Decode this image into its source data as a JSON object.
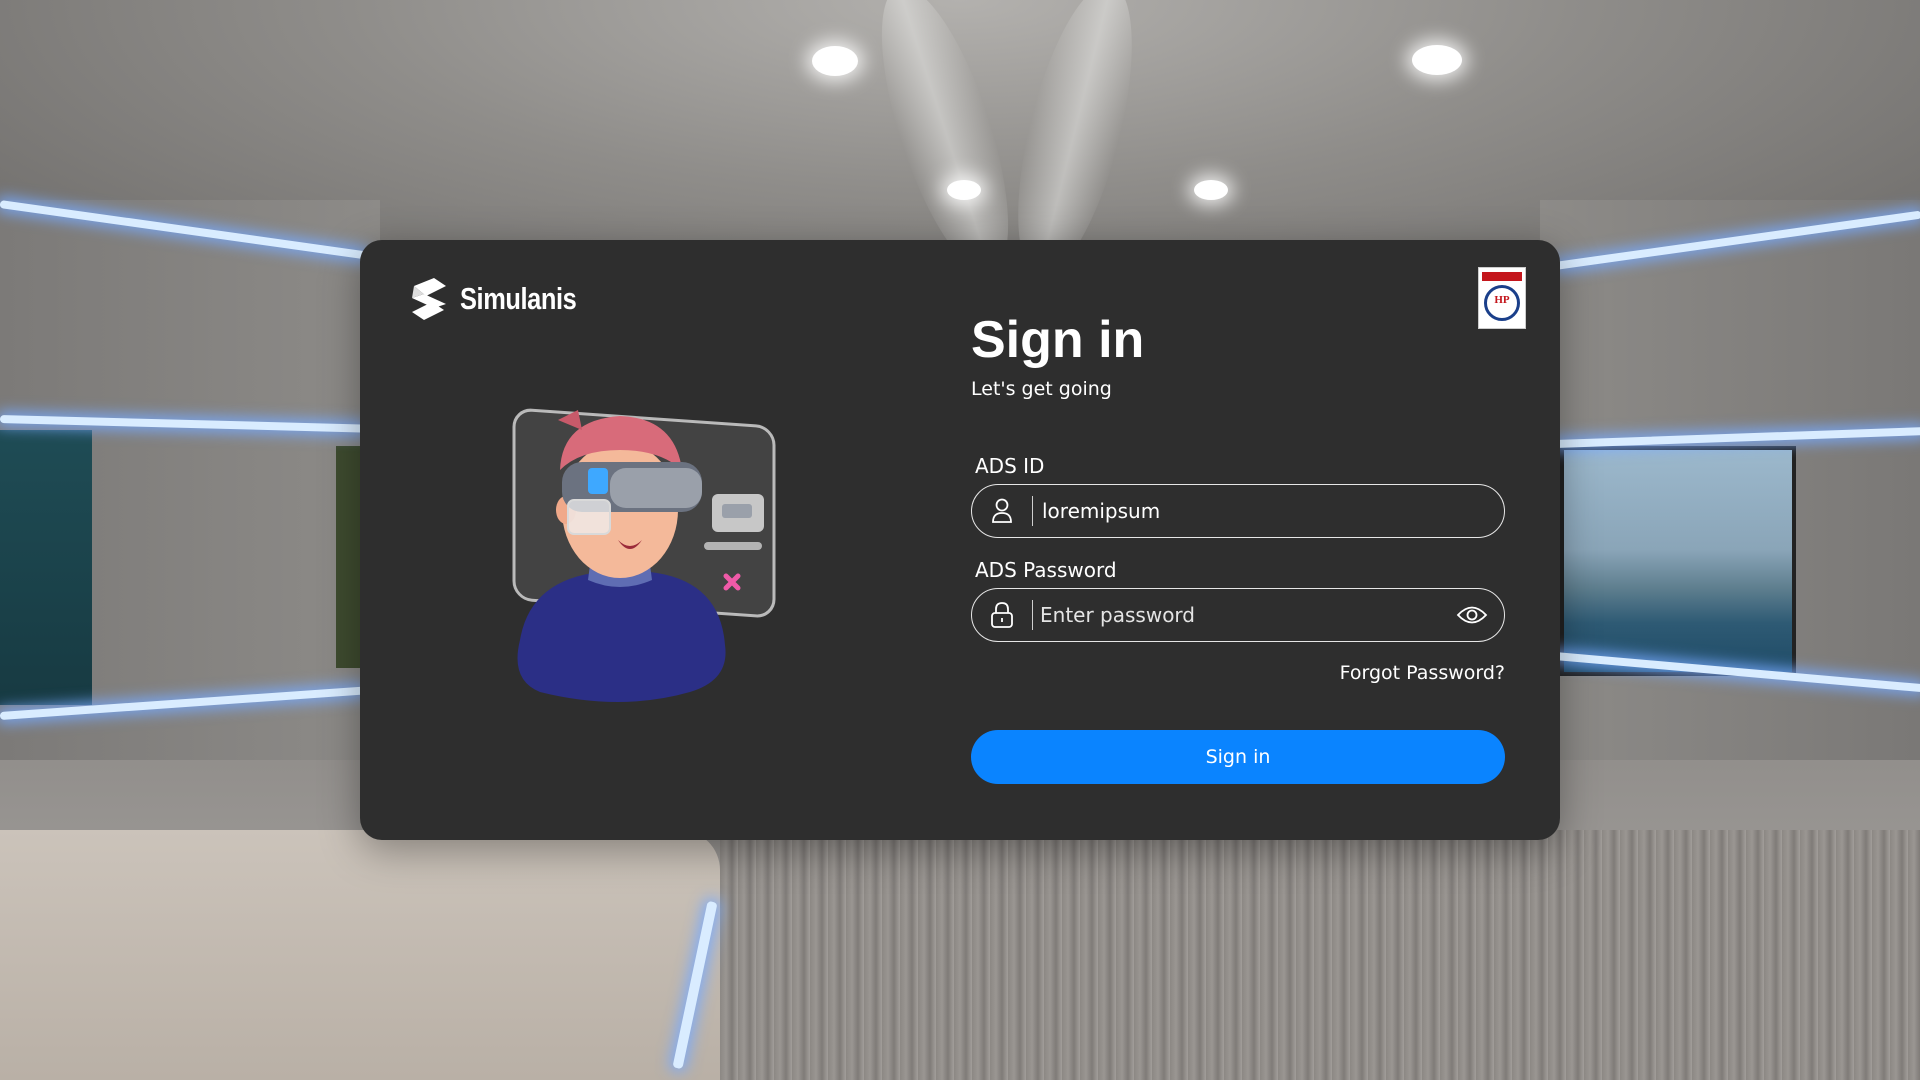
{
  "brand": {
    "name": "Simulanis",
    "logo_icon": "simulanis-logo-icon"
  },
  "partner": {
    "logo_text": "HP",
    "logo_icon": "hp-partner-logo"
  },
  "signin": {
    "title": "Sign in",
    "subtitle": "Let's get going",
    "ads_id_label": "ADS ID",
    "ads_id_value": "loremipsum",
    "password_label": "ADS Password",
    "password_placeholder": "Enter password",
    "forgot_password": "Forgot Password?",
    "submit_label": "Sign in"
  },
  "icons": {
    "user": "user-icon",
    "lock": "lock-icon",
    "eye": "eye-icon"
  },
  "colors": {
    "card_bg": "#2e2e2e",
    "accent": "#0a84ff",
    "text": "#ffffff"
  }
}
